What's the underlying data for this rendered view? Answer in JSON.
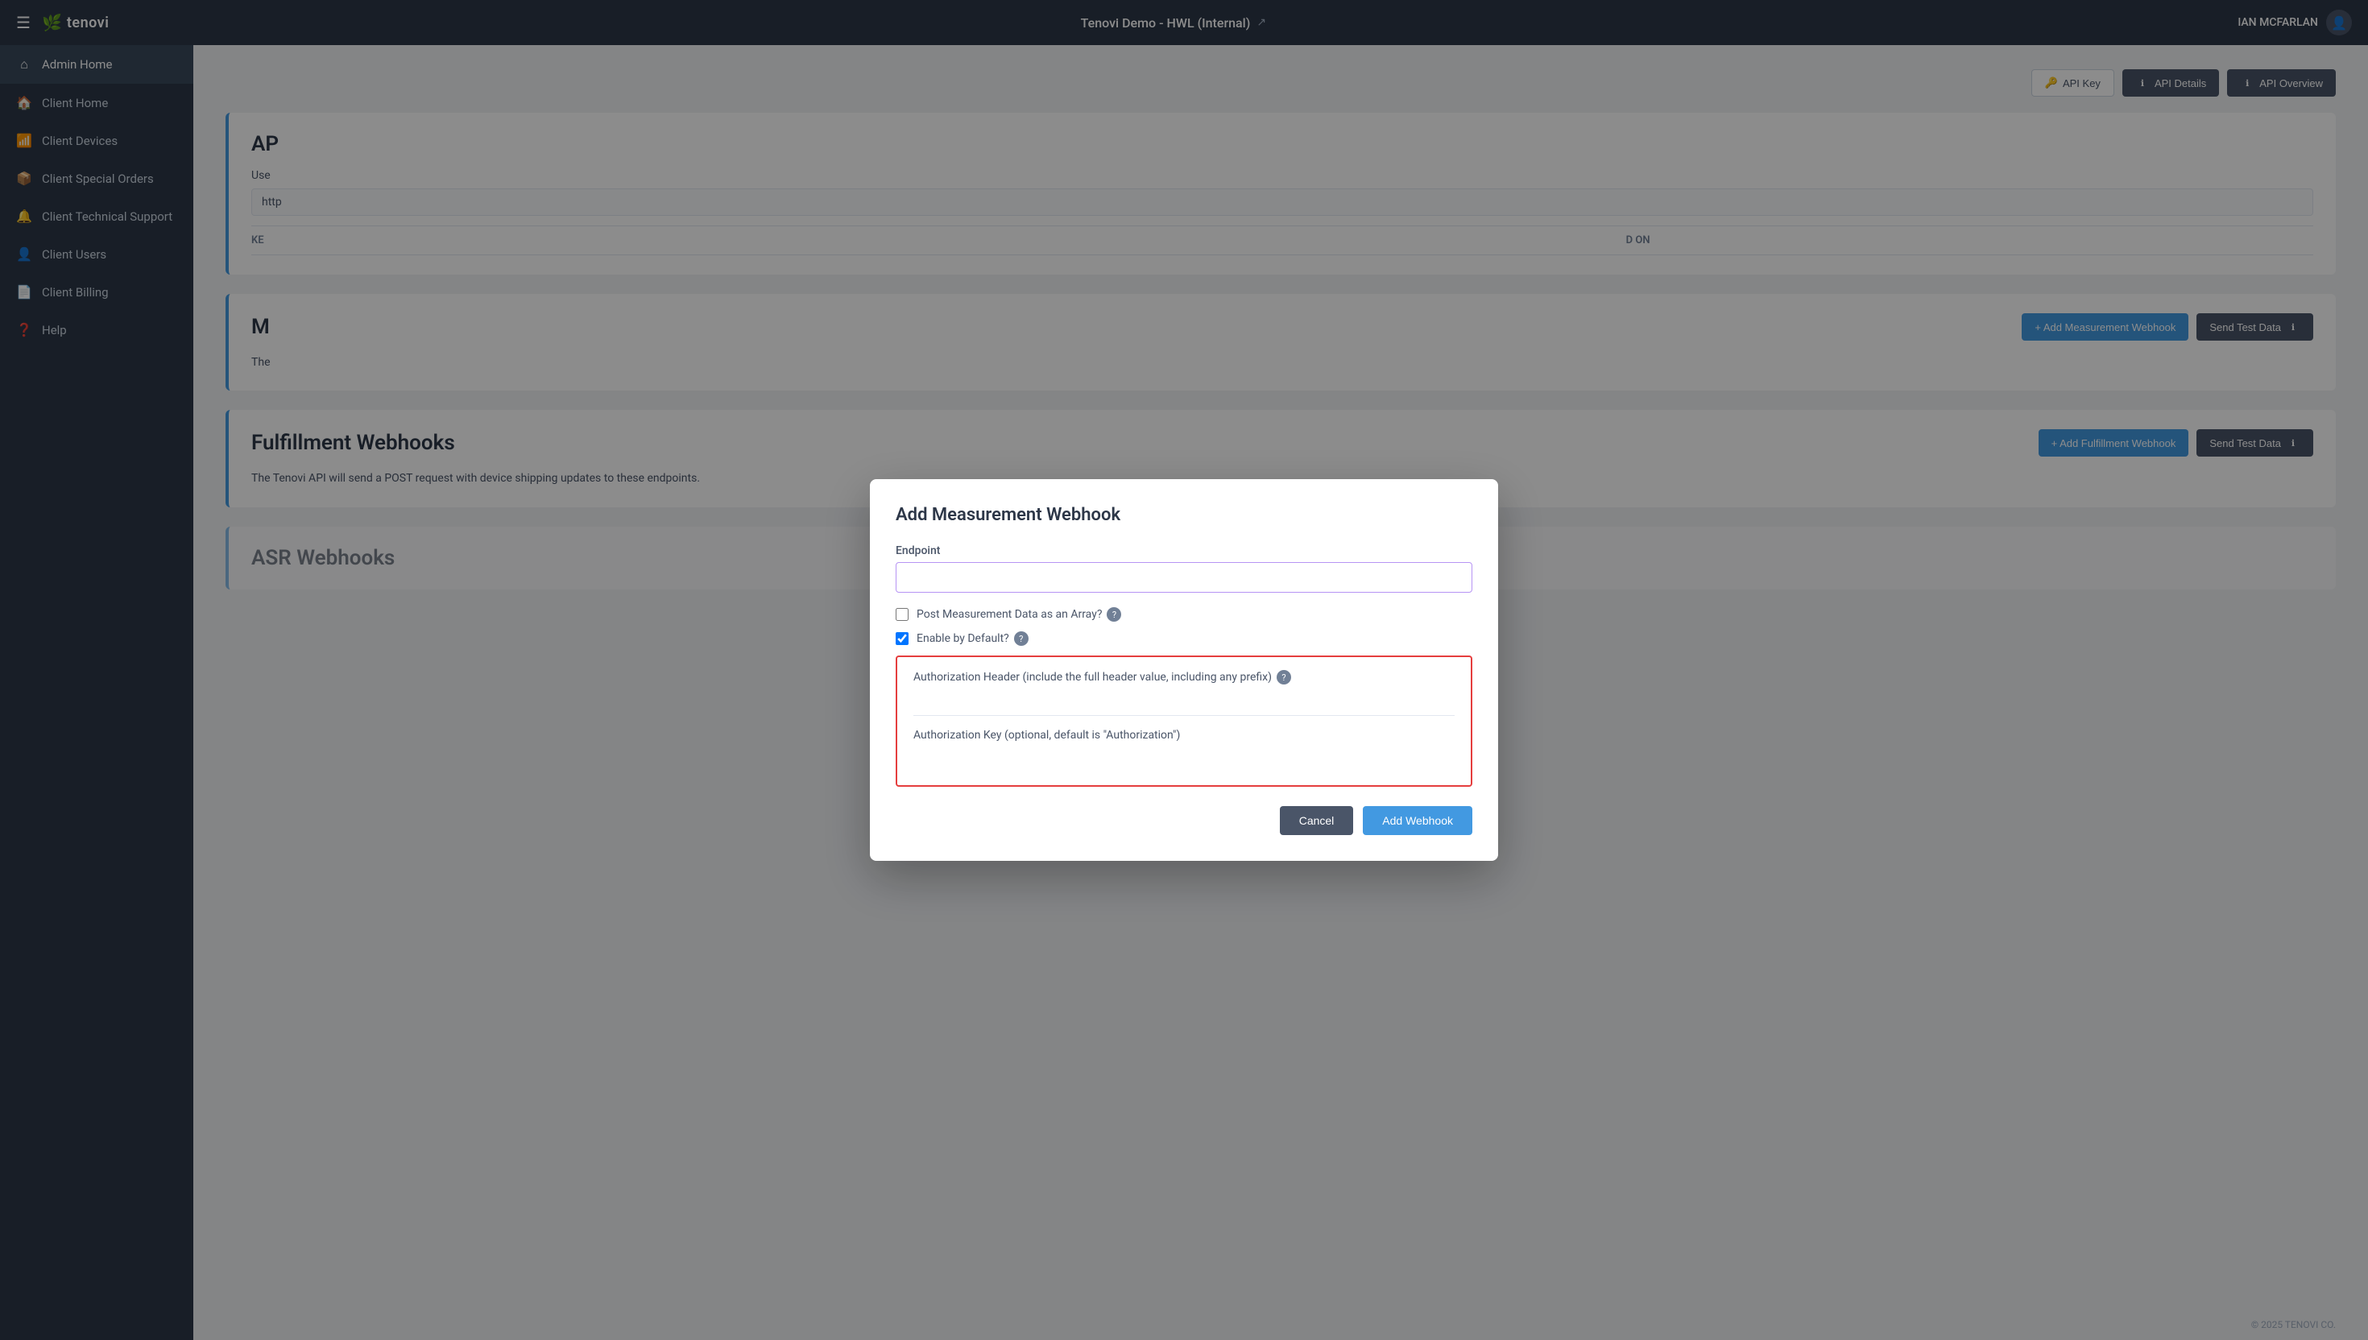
{
  "topNav": {
    "hamburger_label": "☰",
    "logo_icon": "🌿",
    "logo_text": "tenovi",
    "center_text": "Tenovi Demo - HWL (Internal)",
    "share_icon": "↗",
    "user_name": "IAN MCFARLAN"
  },
  "sidebar": {
    "items": [
      {
        "id": "admin-home",
        "icon": "⌂",
        "label": "Admin Home",
        "active": true
      },
      {
        "id": "client-home",
        "icon": "🏠",
        "label": "Client Home",
        "active": false
      },
      {
        "id": "client-devices",
        "icon": "📶",
        "label": "Client Devices",
        "active": false
      },
      {
        "id": "client-special-orders",
        "icon": "📦",
        "label": "Client Special Orders",
        "active": false
      },
      {
        "id": "client-technical-support",
        "icon": "🔔",
        "label": "Client Technical Support",
        "active": false
      },
      {
        "id": "client-users",
        "icon": "👤",
        "label": "Client Users",
        "active": false
      },
      {
        "id": "client-billing",
        "icon": "📄",
        "label": "Client Billing",
        "active": false
      },
      {
        "id": "help",
        "icon": "❓",
        "label": "Help",
        "active": false
      }
    ]
  },
  "topButtons": [
    {
      "id": "api-key",
      "label": "API Key",
      "type": "outline"
    },
    {
      "id": "api-details",
      "label": "API Details",
      "type": "dark-info"
    },
    {
      "id": "api-overview",
      "label": "API Overview",
      "type": "dark-info"
    }
  ],
  "sections": {
    "apiWebhooks": {
      "title": "AP",
      "usersLabel": "Use",
      "usersInput": "http",
      "keyLabel": "Ke",
      "addedOnLabel": "d On"
    },
    "measurementWebhooks": {
      "title": "M",
      "description": "The",
      "addButton": "+ Add Measurement Webhook",
      "testButton": "Send Test Data"
    },
    "fulfillmentWebhooks": {
      "title": "Fulfillment Webhooks",
      "description": "The Tenovi API will send a POST request with device shipping updates to these endpoints.",
      "addButton": "+ Add Fulfillment Webhook",
      "testButton": "Send Test Data"
    },
    "asrWebhooks": {
      "title": "ASR Webhooks"
    }
  },
  "modal": {
    "title": "Add Measurement Webhook",
    "endpointLabel": "Endpoint",
    "endpointPlaceholder": "",
    "checkboxPostLabel": "Post Measurement Data as an Array?",
    "checkboxPostChecked": false,
    "checkboxEnableLabel": "Enable by Default?",
    "checkboxEnableChecked": true,
    "authHeaderLabel": "Authorization Header (include the full header value, including any prefix)",
    "authHeaderPlaceholder": "",
    "authKeyLabel": "Authorization Key (optional, default is \"Authorization\")",
    "authKeyPlaceholder": "",
    "cancelButton": "Cancel",
    "addButton": "Add Webhook"
  },
  "footer": {
    "text": "© 2025 TENOVI CO."
  }
}
